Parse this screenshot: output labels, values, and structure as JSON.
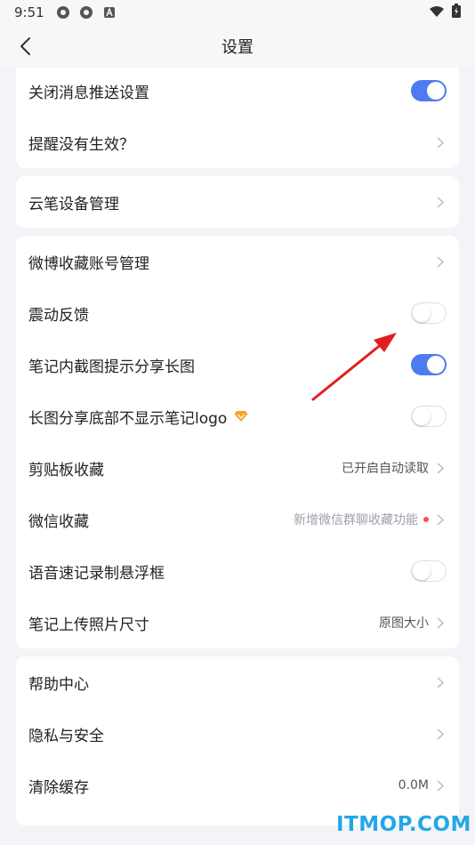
{
  "status_bar": {
    "time": "9:51"
  },
  "header": {
    "title": "设置"
  },
  "section1": {
    "rows": [
      {
        "label": "关闭消息推送设置",
        "toggle": true
      },
      {
        "label": "提醒没有生效？"
      }
    ]
  },
  "section2": {
    "rows": [
      {
        "label": "云笔设备管理"
      }
    ]
  },
  "section3": {
    "rows": [
      {
        "label": "微博收藏账号管理"
      },
      {
        "label": "震动反馈",
        "toggle": false
      },
      {
        "label": "笔记内截图提示分享长图",
        "toggle": true
      },
      {
        "label": "长图分享底部不显示笔记logo",
        "toggle": false,
        "badge": "vip-diamond-icon"
      },
      {
        "label": "剪贴板收藏",
        "value": "已开启自动读取"
      },
      {
        "label": "微信收藏",
        "value": "新增微信群聊收藏功能",
        "dot": true
      },
      {
        "label": "语音速记录制悬浮框",
        "toggle": false
      },
      {
        "label": "笔记上传照片尺寸",
        "value": "原图大小"
      }
    ]
  },
  "section4": {
    "rows": [
      {
        "label": "帮助中心"
      },
      {
        "label": "隐私与安全"
      },
      {
        "label": "清除缓存",
        "value": "0.0M"
      }
    ]
  },
  "watermark": "ITMOP.COM",
  "colors": {
    "accent": "#4f7bf0",
    "background": "#f3f4f7",
    "arrow": "#e02020",
    "watermark": "#23a7e8",
    "badge": "#f5a623"
  }
}
